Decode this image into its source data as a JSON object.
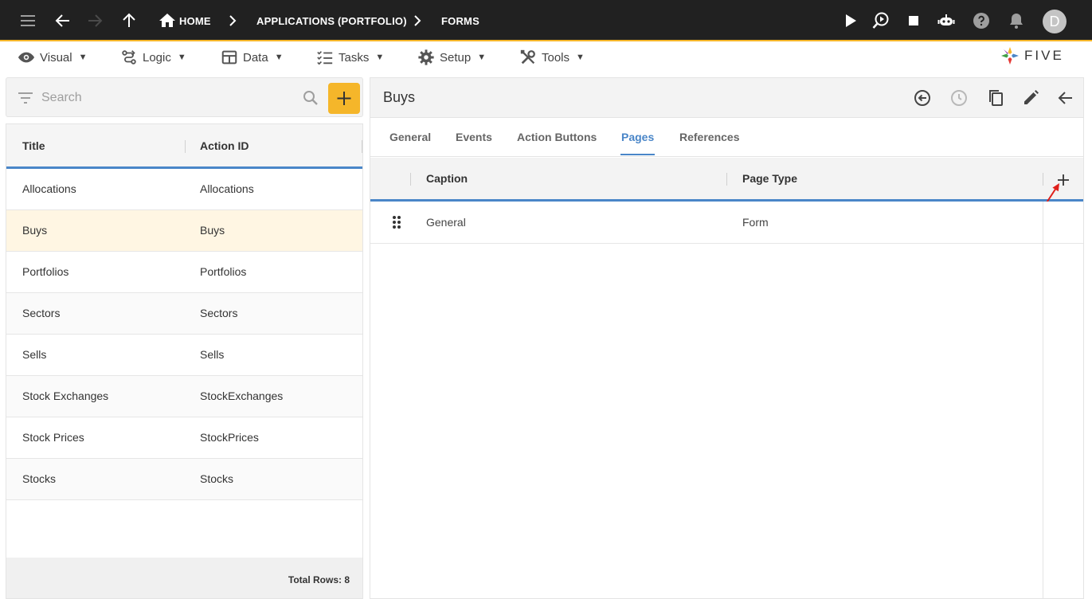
{
  "topbar": {
    "breadcrumbs": [
      "HOME",
      "APPLICATIONS (PORTFOLIO)",
      "FORMS"
    ],
    "avatar_initial": "D",
    "accent_color": "#f5b62a",
    "icons": [
      "menu-icon",
      "back-icon",
      "forward-icon",
      "up-icon",
      "home-icon",
      "chevron-right-icon",
      "play-icon",
      "debug-icon",
      "stop-icon",
      "chat-bot-icon",
      "help-icon",
      "bell-icon"
    ]
  },
  "menu": {
    "items": [
      {
        "label": "Visual",
        "icon": "eye-icon"
      },
      {
        "label": "Logic",
        "icon": "logic-icon"
      },
      {
        "label": "Data",
        "icon": "table-icon"
      },
      {
        "label": "Tasks",
        "icon": "checklist-icon"
      },
      {
        "label": "Setup",
        "icon": "gear-icon"
      },
      {
        "label": "Tools",
        "icon": "tools-icon"
      }
    ],
    "caret": "▼",
    "logo_text": "FIVE"
  },
  "left": {
    "search_placeholder": "Search",
    "columns": [
      "Title",
      "Action ID"
    ],
    "rows": [
      {
        "title": "Allocations",
        "action_id": "Allocations"
      },
      {
        "title": "Buys",
        "action_id": "Buys"
      },
      {
        "title": "Portfolios",
        "action_id": "Portfolios"
      },
      {
        "title": "Sectors",
        "action_id": "Sectors"
      },
      {
        "title": "Sells",
        "action_id": "Sells"
      },
      {
        "title": "Stock Exchanges",
        "action_id": "StockExchanges"
      },
      {
        "title": "Stock Prices",
        "action_id": "StockPrices"
      },
      {
        "title": "Stocks",
        "action_id": "Stocks"
      }
    ],
    "selected": "Buys",
    "total_rows": "Total Rows: 8"
  },
  "form": {
    "title": "Buys",
    "tabs": [
      "General",
      "Events",
      "Action Buttons",
      "Pages",
      "References"
    ],
    "active_tab": "Pages",
    "grid": {
      "columns": [
        "Caption",
        "Page Type"
      ],
      "rows": [
        {
          "caption": "General",
          "page_type": "Form"
        }
      ]
    },
    "header_icons": [
      "history-back-icon",
      "clock-icon",
      "copy-icon",
      "edit-icon",
      "arrow-back-icon"
    ]
  }
}
